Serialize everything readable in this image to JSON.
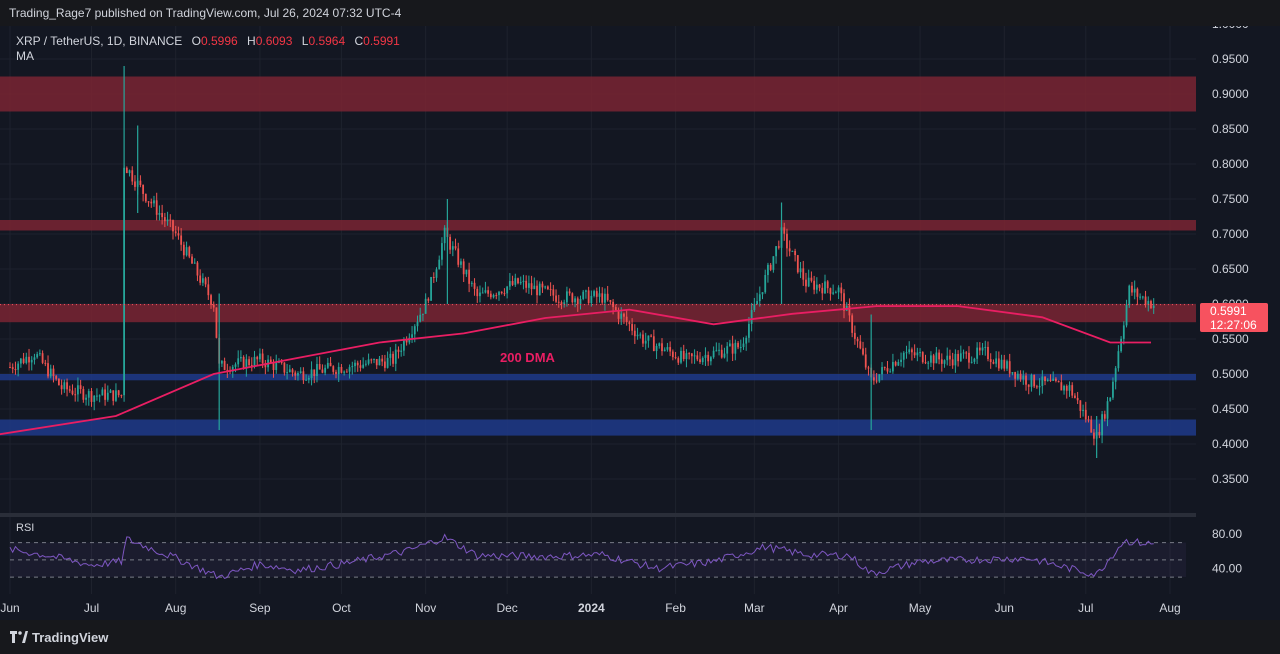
{
  "header": {
    "publisher_text": "Trading_Rage7 published on TradingView.com, Jul 26, 2024 07:32 UTC-4"
  },
  "legend": {
    "symbol": "XRP / TetherUS, 1D, BINANCE",
    "open_label": "O",
    "open": "0.5996",
    "high_label": "H",
    "high": "0.6093",
    "low_label": "L",
    "low": "0.5964",
    "close_label": "C",
    "close": "0.5991",
    "indicator": "MA"
  },
  "price_tag": {
    "price": "0.5991",
    "countdown": "12:27:06"
  },
  "annotation": {
    "dma": "200 DMA"
  },
  "rsi": {
    "label": "RSI"
  },
  "footer": {
    "brand": "TradingView"
  },
  "colors": {
    "up": "#26a69a",
    "down": "#ef5350",
    "ma": "#e91e63",
    "rsi_line": "#7e57c2",
    "resistance_zone": "#7a2433",
    "support_zone": "#1f3a8a",
    "background": "#131722"
  },
  "chart_data": [
    {
      "type": "candlestick",
      "title": "",
      "x_ticks": [
        "Jun",
        "Jul",
        "Aug",
        "Sep",
        "Oct",
        "Nov",
        "Dec",
        "2024",
        "Feb",
        "Mar",
        "Apr",
        "May",
        "Jun",
        "Jul",
        "Aug"
      ],
      "y_ticks": [
        "1.0000",
        "0.9500",
        "0.9000",
        "0.8500",
        "0.8000",
        "0.7500",
        "0.7000",
        "0.6500",
        "0.6000",
        "0.5500",
        "0.5000",
        "0.4500",
        "0.4000",
        "0.3500"
      ],
      "ylim": [
        0.31,
        1.01
      ],
      "price_path_x": [
        "2023-06-01",
        "2023-06-10",
        "2023-06-20",
        "2023-07-01",
        "2023-07-12",
        "2023-07-13",
        "2023-07-20",
        "2023-08-01",
        "2023-08-15",
        "2023-08-17",
        "2023-09-01",
        "2023-09-15",
        "2023-10-01",
        "2023-10-20",
        "2023-11-01",
        "2023-11-08",
        "2023-11-20",
        "2023-12-05",
        "2023-12-20",
        "2024-01-05",
        "2024-01-20",
        "2024-02-05",
        "2024-02-25",
        "2024-03-11",
        "2024-03-20",
        "2024-04-01",
        "2024-04-13",
        "2024-04-25",
        "2024-05-10",
        "2024-05-25",
        "2024-06-10",
        "2024-06-25",
        "2024-07-05",
        "2024-07-10",
        "2024-07-17",
        "2024-07-26"
      ],
      "price_path_y": [
        0.51,
        0.53,
        0.48,
        0.47,
        0.47,
        0.8,
        0.76,
        0.7,
        0.6,
        0.51,
        0.52,
        0.5,
        0.51,
        0.52,
        0.6,
        0.7,
        0.61,
        0.63,
        0.61,
        0.61,
        0.55,
        0.52,
        0.54,
        0.7,
        0.63,
        0.62,
        0.49,
        0.53,
        0.52,
        0.53,
        0.49,
        0.48,
        0.41,
        0.47,
        0.62,
        0.5991
      ],
      "series": [
        {
          "name": "200 DMA",
          "x": [
            "2023-05-25",
            "2023-07-10",
            "2023-08-15",
            "2023-09-15",
            "2023-10-15",
            "2023-11-15",
            "2023-12-15",
            "2024-01-15",
            "2024-02-15",
            "2024-03-15",
            "2024-04-15",
            "2024-05-15",
            "2024-06-15",
            "2024-07-10",
            "2024-07-25"
          ],
          "y": [
            0.412,
            0.44,
            0.5,
            0.523,
            0.545,
            0.558,
            0.58,
            0.592,
            0.571,
            0.586,
            0.597,
            0.597,
            0.581,
            0.545,
            0.545
          ]
        }
      ],
      "zones": [
        {
          "kind": "resistance",
          "low": 0.875,
          "high": 0.925
        },
        {
          "kind": "resistance",
          "low": 0.705,
          "high": 0.72
        },
        {
          "kind": "resistance",
          "low": 0.574,
          "high": 0.6
        },
        {
          "kind": "support",
          "low": 0.491,
          "high": 0.5
        },
        {
          "kind": "support",
          "low": 0.412,
          "high": 0.435
        }
      ]
    },
    {
      "type": "line",
      "title": "RSI",
      "y_ticks": [
        "80.00",
        "40.00"
      ],
      "levels": [
        70,
        50,
        30
      ],
      "x": [
        "2023-06-01",
        "2023-06-15",
        "2023-07-01",
        "2023-07-12",
        "2023-07-14",
        "2023-08-01",
        "2023-08-17",
        "2023-09-01",
        "2023-09-15",
        "2023-10-01",
        "2023-10-25",
        "2023-11-08",
        "2023-11-20",
        "2023-12-15",
        "2024-01-05",
        "2024-01-25",
        "2024-02-15",
        "2024-03-05",
        "2024-03-20",
        "2024-04-05",
        "2024-04-13",
        "2024-05-01",
        "2024-05-20",
        "2024-06-10",
        "2024-06-25",
        "2024-07-05",
        "2024-07-15",
        "2024-07-26"
      ],
      "y": [
        62,
        55,
        44,
        48,
        74,
        52,
        30,
        45,
        38,
        45,
        60,
        76,
        55,
        54,
        56,
        40,
        48,
        65,
        56,
        55,
        34,
        48,
        50,
        52,
        40,
        33,
        72,
        68
      ]
    }
  ]
}
